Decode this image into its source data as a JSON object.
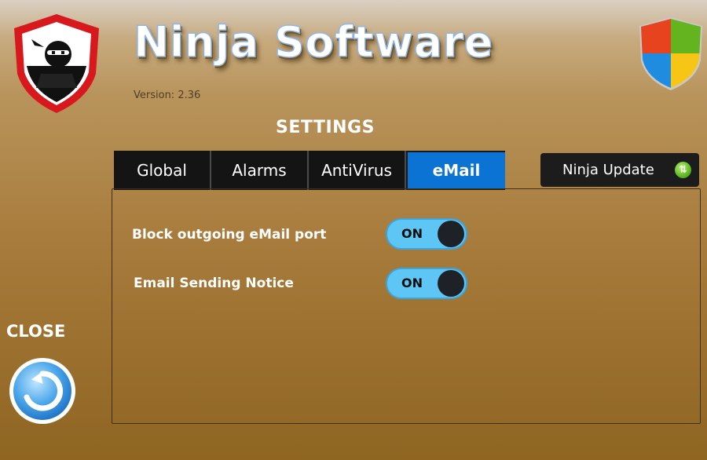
{
  "app": {
    "title": "Ninja Software",
    "version": "Version: 2.36"
  },
  "settings_heading": "SETTINGS",
  "tabs": [
    {
      "label": "Global",
      "active": false
    },
    {
      "label": "Alarms",
      "active": false
    },
    {
      "label": "AntiVirus",
      "active": false
    },
    {
      "label": "eMail",
      "active": true
    }
  ],
  "ninja_update": {
    "label": "Ninja Update",
    "icon": "refresh-icon"
  },
  "email_settings": [
    {
      "label": "Block outgoing eMail port",
      "state": "ON"
    },
    {
      "label": "Email Sending Notice",
      "state": "ON"
    }
  ],
  "close": {
    "label": "CLOSE",
    "icon": "back-arrow-icon"
  },
  "colors": {
    "active_tab": "#0a73d4",
    "tab_bg": "#141414",
    "toggle_on": "#5ec6f5",
    "background_top": "#c7aa7e",
    "background_bottom": "#8f6522"
  }
}
